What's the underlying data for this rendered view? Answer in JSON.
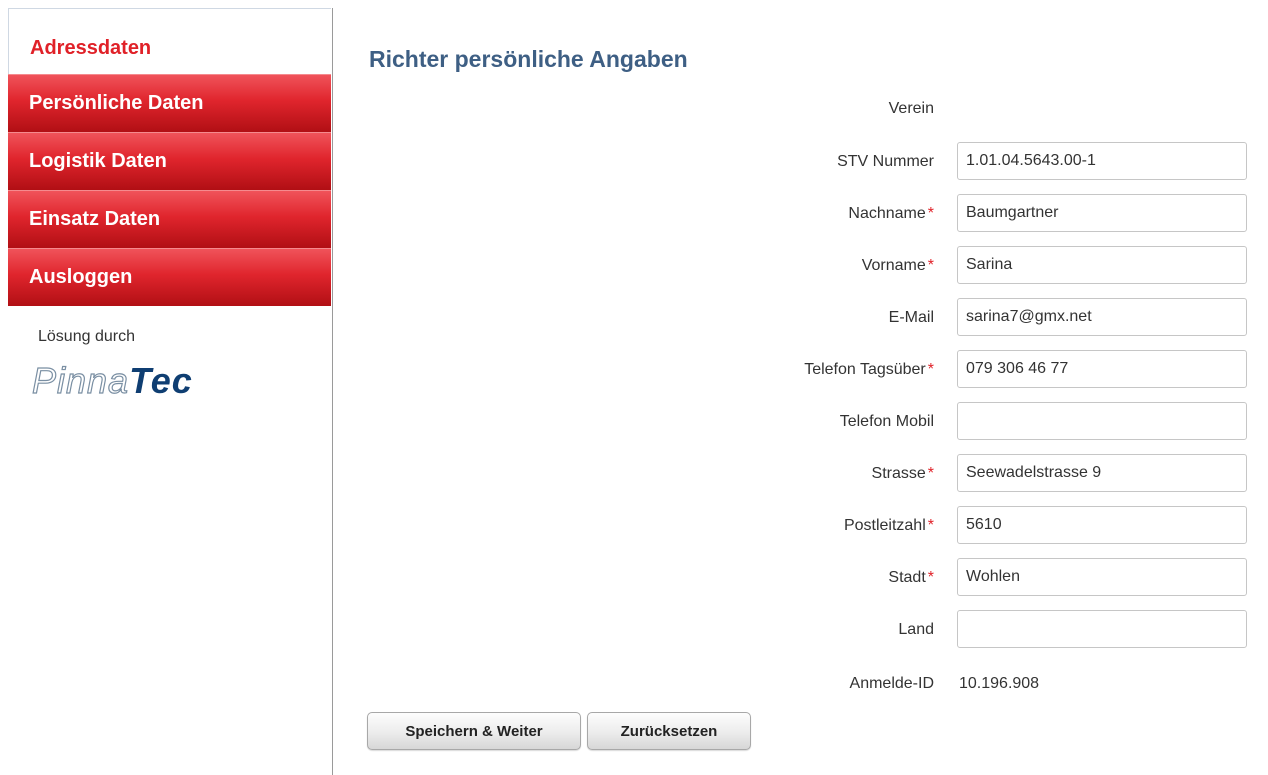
{
  "sidebar": {
    "items": [
      {
        "label": "Adressdaten"
      },
      {
        "label": "Persönliche Daten"
      },
      {
        "label": "Logistik Daten"
      },
      {
        "label": "Einsatz Daten"
      },
      {
        "label": "Ausloggen"
      }
    ],
    "credit": "Lösung durch",
    "logo": {
      "part1": "Pinna",
      "part2": "Tec"
    }
  },
  "colors": {
    "accent": "#e02128",
    "title": "#3e5f84",
    "logo": "#0f3e72"
  },
  "main": {
    "title": "Richter persönliche Angaben",
    "form": {
      "verein": {
        "label": "Verein"
      },
      "stv_nummer": {
        "label": "STV Nummer",
        "value": "1.01.04.5643.00-1"
      },
      "nachname": {
        "label": "Nachname",
        "value": "Baumgartner",
        "required": "*"
      },
      "vorname": {
        "label": "Vorname",
        "value": "Sarina",
        "required": "*"
      },
      "email": {
        "label": "E-Mail",
        "value": "sarina7@gmx.net"
      },
      "telefon_tag": {
        "label": "Telefon Tagsüber",
        "value": "079 306 46 77",
        "required": "*"
      },
      "telefon_mobil": {
        "label": "Telefon Mobil",
        "value": ""
      },
      "strasse": {
        "label": "Strasse",
        "value": "Seewadelstrasse 9",
        "required": "*"
      },
      "plz": {
        "label": "Postleitzahl",
        "value": "5610",
        "required": "*"
      },
      "stadt": {
        "label": "Stadt",
        "value": "Wohlen",
        "required": "*"
      },
      "land": {
        "label": "Land",
        "value": ""
      },
      "anmelde_id": {
        "label": "Anmelde-ID",
        "value": "10.196.908"
      }
    },
    "buttons": {
      "save": "Speichern & Weiter",
      "reset": "Zurücksetzen"
    }
  }
}
